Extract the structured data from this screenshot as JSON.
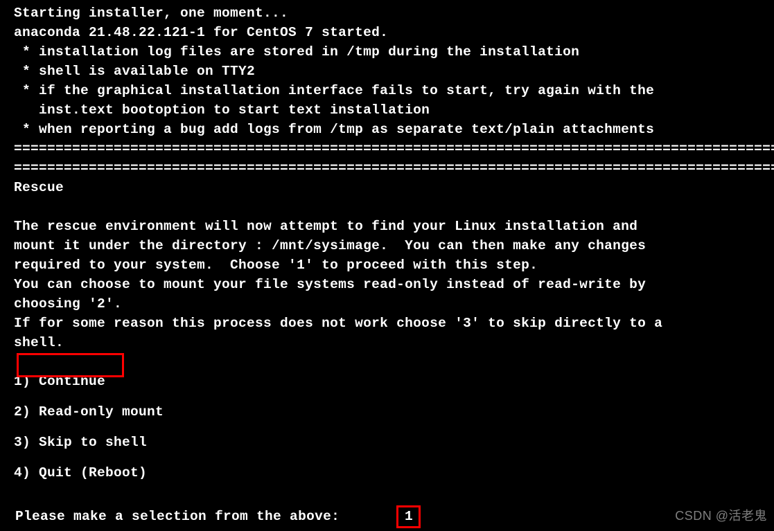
{
  "header": {
    "line1": "Starting installer, one moment...",
    "line2": "anaconda 21.48.22.121-1 for CentOS 7 started.",
    "bullet1": " * installation log files are stored in /tmp during the installation",
    "bullet2": " * shell is available on TTY2",
    "bullet3a": " * if the graphical installation interface fails to start, try again with the",
    "bullet3b": "   inst.text bootoption to start text installation",
    "bullet4": " * when reporting a bug add logs from /tmp as separate text/plain attachments"
  },
  "divider": "================================================================================================================",
  "rescue": {
    "title": "Rescue",
    "para1a": "The rescue environment will now attempt to find your Linux installation and",
    "para1b": "mount it under the directory : /mnt/sysimage.  You can then make any changes",
    "para1c": "required to your system.  Choose '1' to proceed with this step.",
    "para2a": "You can choose to mount your file systems read-only instead of read-write by",
    "para2b": "choosing '2'.",
    "para3a": "If for some reason this process does not work choose '3' to skip directly to a",
    "para3b": "shell."
  },
  "options": {
    "opt1": "1) Continue",
    "opt2": "2) Read-only mount",
    "opt3": "3) Skip to shell",
    "opt4": "4) Quit (Reboot)"
  },
  "prompt": {
    "label": "Please make a selection from the above: ",
    "value": "1"
  },
  "watermark": "CSDN @活老鬼"
}
